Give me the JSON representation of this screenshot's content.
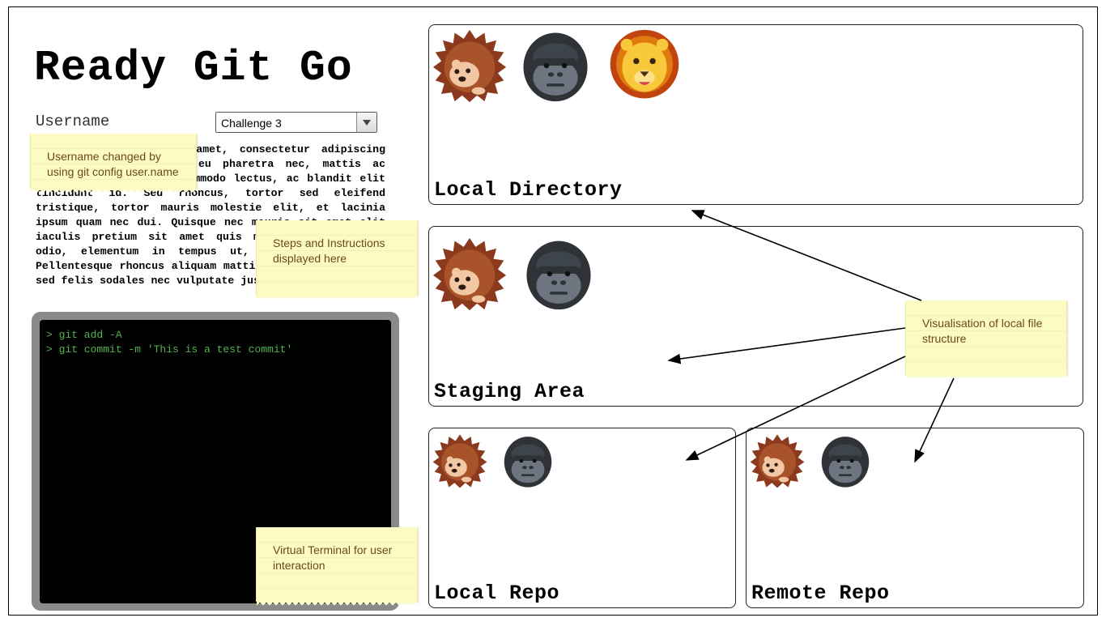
{
  "app": {
    "title": "Ready Git Go",
    "username_label": "Username",
    "challenge_select": {
      "selected": "Challenge 3"
    }
  },
  "instructions": {
    "text": "Lorem ipsum dolor sit amet, consectetur adipiscing elit. Nullam vulputate eu pharetra nec, mattis ac neque. Duis vulputate commodo lectus, ac blandit elit tincidunt id. Sed rhoncus, tortor sed eleifend tristique, tortor mauris molestie elit, et lacinia ipsum quam nec dui. Quisque nec mauris sit amet elit iaculis pretium sit amet quis magna. Aenean velit odio, elementum in tempus ut, vehicula eu diam. Pellentesque rhoncus aliquam mattis. Ut vulputate eros sed felis sodales nec vulputate justo"
  },
  "terminal": {
    "lines": [
      "> git add -A",
      "> git commit -m 'This is a test commit'"
    ]
  },
  "panels": {
    "local_directory": {
      "label": "Local Directory",
      "icons": [
        "hedgehog-icon",
        "gorilla-icon",
        "lion-icon"
      ]
    },
    "staging_area": {
      "label": "Staging Area",
      "icons": [
        "hedgehog-icon",
        "gorilla-icon"
      ]
    },
    "local_repo": {
      "label": "Local Repo",
      "icons": [
        "hedgehog-icon",
        "gorilla-icon"
      ]
    },
    "remote_repo": {
      "label": "Remote Repo",
      "icons": [
        "hedgehog-icon",
        "gorilla-icon"
      ]
    }
  },
  "notes": {
    "username": "Username changed by using git config user.name",
    "steps": "Steps and Instructions displayed here",
    "terminal": "Virtual Terminal for user interaction",
    "visualisation": "Visualisation of local file structure"
  },
  "colors": {
    "terminal_text": "#52b34c",
    "terminal_bg": "#000000",
    "terminal_bezel": "#8a8a8a",
    "note_bg": "#fdfbc4",
    "note_text": "#6b4a14"
  }
}
